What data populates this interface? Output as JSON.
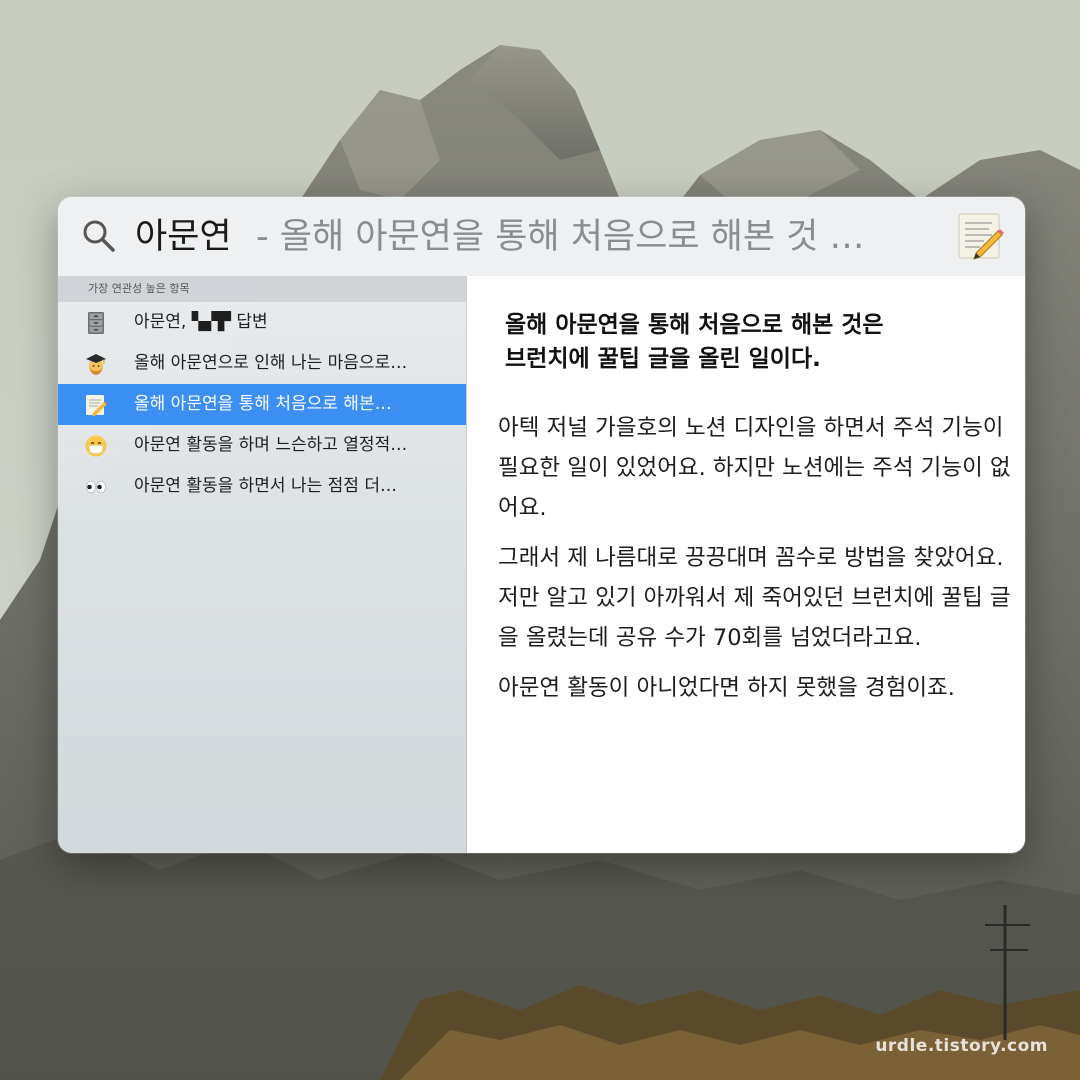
{
  "search": {
    "query": "아문연",
    "completion": "- 올해 아문연을 통해 처음으로 해본 것 …"
  },
  "results": {
    "section_header": "가장 연관성 높은 항목",
    "items": [
      {
        "icon": "file-cabinet-icon",
        "label": "아문연, ▚▞▛ 답변"
      },
      {
        "icon": "student-icon",
        "label": "올해 아문연으로 인해 나는 마음으로…"
      },
      {
        "icon": "memo-icon",
        "label": "올해 아문연을 통해 처음으로 해본…"
      },
      {
        "icon": "mask-face-icon",
        "label": "아문연 활동을 하며 느슨하고 열정적…"
      },
      {
        "icon": "eyes-icon",
        "label": "아문연 활동을 하면서 나는 점점 더…"
      }
    ],
    "selected_index": 2
  },
  "preview": {
    "headline_lines": [
      "올해 아문연을 통해 처음으로 해본 것은",
      "브런치에 꿀팁 글을 올린 일이다."
    ],
    "paragraphs": [
      "아텍 저널 가을호의 노션 디자인을 하면서 주석 기능이 필요한 일이 있었어요. 하지만 노션에는 주석 기능이 없어요.",
      "그래서 제 나름대로 끙끙대며 꼼수로 방법을 찾았어요. 저만 알고 있기 아까워서 제 죽어있던 브런치에 꿀팁 글을 올렸는데 공유 수가 70회를 넘었더라고요.",
      "아문연 활동이 아니었다면 하지 못했을 경험이죠."
    ]
  },
  "watermark": "urdle.tistory.com",
  "colors": {
    "selection": "#3b8ef2",
    "completion_text": "#8a8d90"
  }
}
